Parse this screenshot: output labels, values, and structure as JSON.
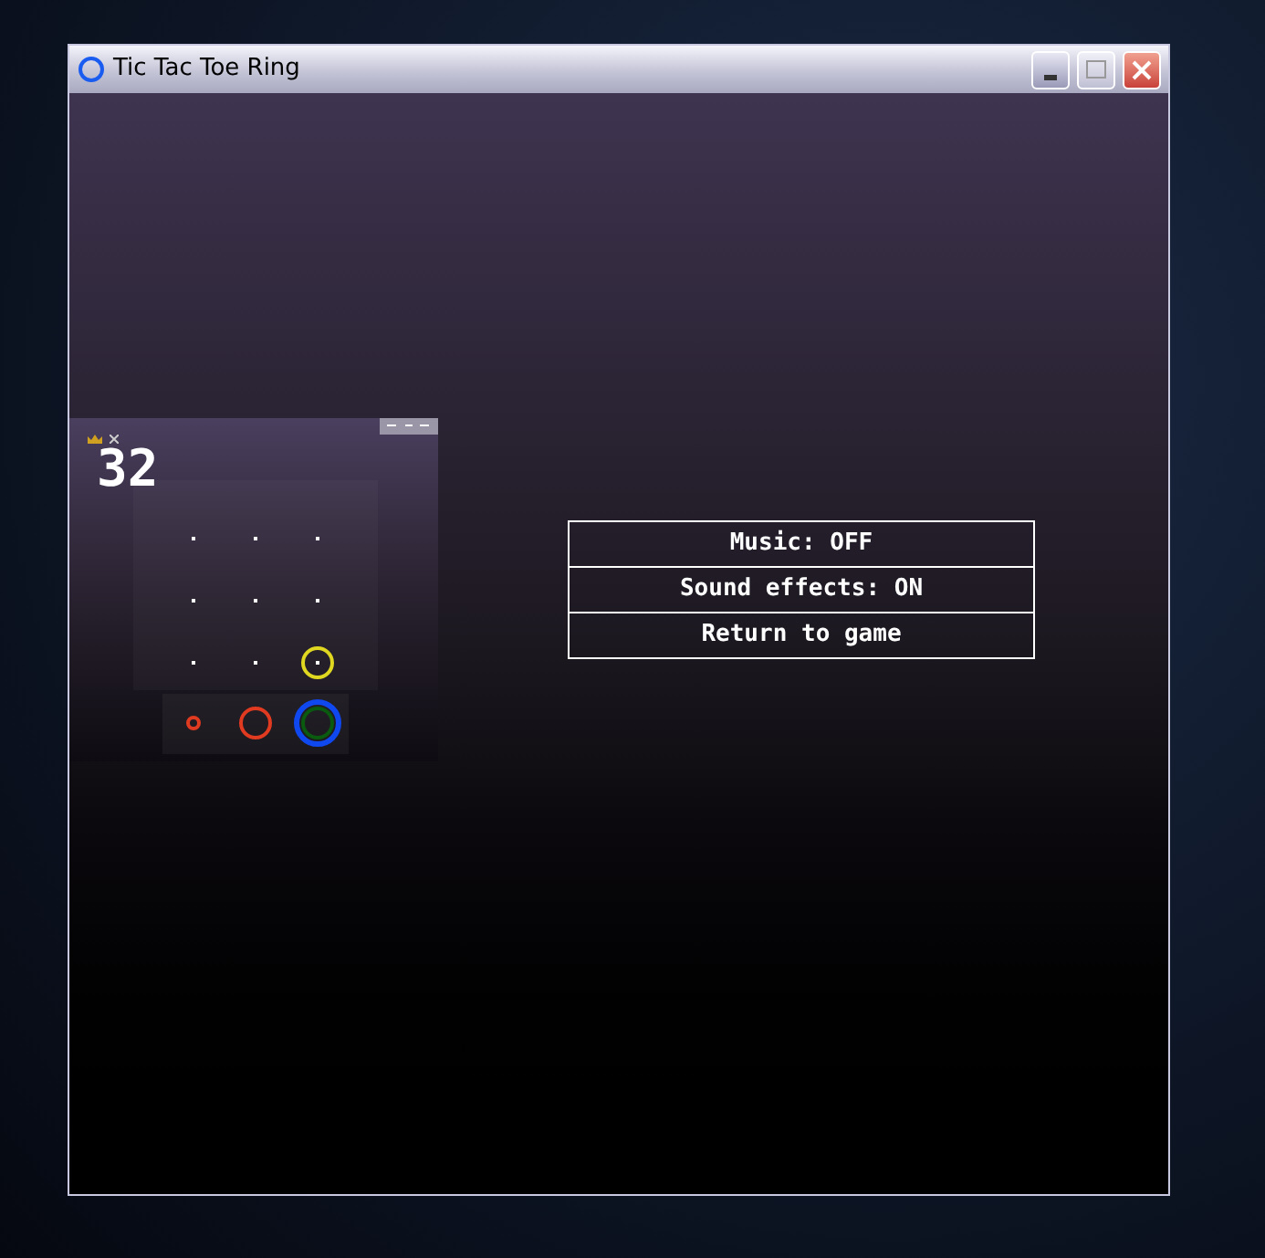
{
  "window": {
    "title": "Tic Tac Toe Ring"
  },
  "game": {
    "score": "32",
    "board": [
      {
        "kind": "empty"
      },
      {
        "kind": "empty"
      },
      {
        "kind": "empty"
      },
      {
        "kind": "empty"
      },
      {
        "kind": "empty"
      },
      {
        "kind": "empty"
      },
      {
        "kind": "empty"
      },
      {
        "kind": "empty"
      },
      {
        "kind": "occupied",
        "rings": [
          {
            "kind": "medium",
            "color": "#e0d820"
          }
        ]
      }
    ],
    "tray": [
      {
        "rings": [
          {
            "kind": "small",
            "color": "#e03a20"
          }
        ]
      },
      {
        "rings": [
          {
            "kind": "medium",
            "color": "#e03a20"
          }
        ]
      },
      {
        "rings": [
          {
            "kind": "large",
            "color": "#1048f0"
          },
          {
            "kind": "medium",
            "color": "#0a5a10"
          }
        ]
      }
    ]
  },
  "menu": [
    {
      "label": "Music: OFF"
    },
    {
      "label": "Sound effects: ON"
    },
    {
      "label": "Return to game"
    }
  ]
}
